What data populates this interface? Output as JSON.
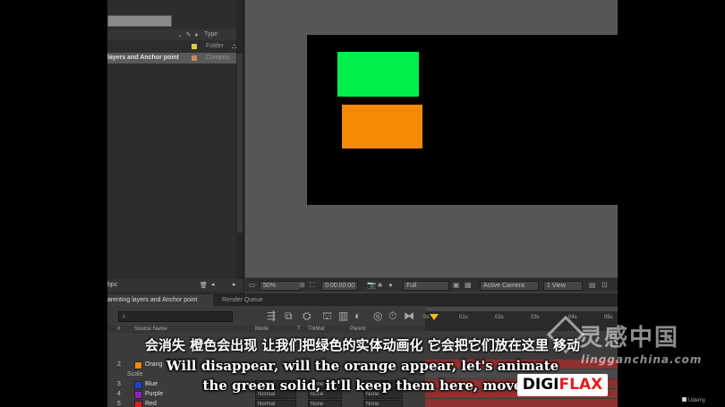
{
  "project_panel": {
    "header": {
      "icons": "⌄ ✎ ♦",
      "type_label": "Type"
    },
    "rows": [
      {
        "name": "",
        "type": "Folder",
        "color": "#e0c848",
        "type_icon": "⛬"
      },
      {
        "name": "layers and Anchor point",
        "type": "Compos",
        "color": "#c88a5a",
        "type_icon": ""
      }
    ],
    "footer": {
      "bpc": "bpc",
      "trash": "🗑",
      "left": "◂",
      "right": "▸"
    }
  },
  "viewer": {
    "zoom": "50%",
    "timecode": "0:00:00:00",
    "resolution": "Full",
    "camera": "Active Camera",
    "view": "1 View",
    "solids": [
      {
        "color": "#00ef4a"
      },
      {
        "color": "#f58a07"
      }
    ]
  },
  "timeline": {
    "tabs": {
      "active": "arenting layers and Anchor point",
      "render_queue": "Render Queue"
    },
    "ruler": {
      "ticks": [
        "0s",
        "01s",
        "02s",
        "03s",
        "04s",
        "05s"
      ]
    },
    "columns": {
      "num": "#",
      "source_name": "Source Name",
      "mode": "Mode",
      "t": "T",
      "trkmat": "TrkMat",
      "parent": "Parent"
    },
    "layers": [
      {
        "num": "2",
        "name": "Orang",
        "color": "#f58a07",
        "mode": "",
        "trkmat": "",
        "parent": ""
      },
      {
        "num": "",
        "name": "Scale",
        "color": "",
        "mode": "",
        "trkmat": "",
        "parent": ""
      },
      {
        "num": "3",
        "name": "Blue",
        "color": "#2040e0",
        "mode": "Normal",
        "trkmat": "None",
        "parent": "None"
      },
      {
        "num": "4",
        "name": "Purple",
        "color": "#9020c0",
        "mode": "Normal",
        "trkmat": "None",
        "parent": "None"
      },
      {
        "num": "5",
        "name": "Red",
        "color": "#e02020",
        "mode": "Normal",
        "trkmat": "None",
        "parent": "None"
      }
    ]
  },
  "subtitles": {
    "chinese": "会消失 橙色会出现 让我们把绿色的实体动画化 它会把它们放在这里 移动",
    "english_line1": "Will disappear, will the orange appear, let's animate",
    "english_line2": "the green solid, it'll keep them here, move"
  },
  "watermark": {
    "brand_cn": "灵感中国",
    "url": "lingganchina.com"
  },
  "logo": {
    "part1": "DIGI",
    "part2": "FLAX"
  },
  "udemy": "Udemy"
}
